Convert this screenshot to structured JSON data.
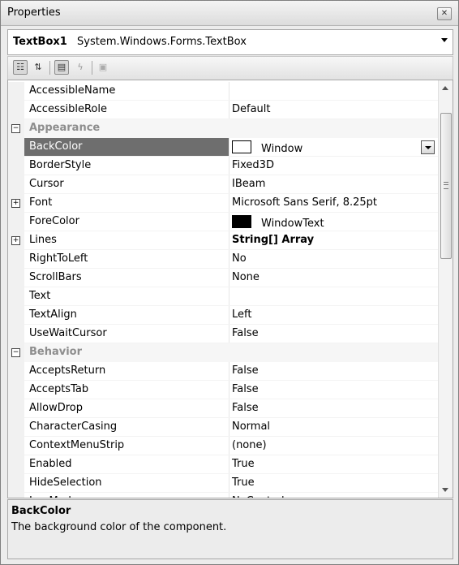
{
  "window": {
    "title": "Properties"
  },
  "object_selector": {
    "name": "TextBox1",
    "type": "System.Windows.Forms.TextBox"
  },
  "toolbar": {
    "categorized_icon": "categorized-icon",
    "alphabetical_icon": "alphabetical-icon",
    "properties_icon": "properties-icon",
    "events_icon": "events-icon",
    "property_pages_icon": "property-pages-icon"
  },
  "grid": {
    "rows": [
      {
        "kind": "prop",
        "name": "AccessibleName",
        "value": ""
      },
      {
        "kind": "prop",
        "name": "AccessibleRole",
        "value": "Default"
      },
      {
        "kind": "cat",
        "name": "Appearance",
        "expander": "⊟"
      },
      {
        "kind": "prop",
        "name": "BackColor",
        "value": "Window",
        "selected": true,
        "swatch": "#ffffff"
      },
      {
        "kind": "prop",
        "name": "BorderStyle",
        "value": "Fixed3D"
      },
      {
        "kind": "prop",
        "name": "Cursor",
        "value": "IBeam"
      },
      {
        "kind": "prop",
        "name": "Font",
        "value": "Microsoft Sans Serif, 8.25pt",
        "expander": "+"
      },
      {
        "kind": "prop",
        "name": "ForeColor",
        "value": "WindowText",
        "swatch": "#000000"
      },
      {
        "kind": "prop",
        "name": "Lines",
        "value": "String[] Array",
        "expander": "+",
        "bold_value": true
      },
      {
        "kind": "prop",
        "name": "RightToLeft",
        "value": "No"
      },
      {
        "kind": "prop",
        "name": "ScrollBars",
        "value": "None"
      },
      {
        "kind": "prop",
        "name": "Text",
        "value": ""
      },
      {
        "kind": "prop",
        "name": "TextAlign",
        "value": "Left"
      },
      {
        "kind": "prop",
        "name": "UseWaitCursor",
        "value": "False"
      },
      {
        "kind": "cat",
        "name": "Behavior",
        "expander": "⊟"
      },
      {
        "kind": "prop",
        "name": "AcceptsReturn",
        "value": "False"
      },
      {
        "kind": "prop",
        "name": "AcceptsTab",
        "value": "False"
      },
      {
        "kind": "prop",
        "name": "AllowDrop",
        "value": "False"
      },
      {
        "kind": "prop",
        "name": "CharacterCasing",
        "value": "Normal"
      },
      {
        "kind": "prop",
        "name": "ContextMenuStrip",
        "value": "(none)"
      },
      {
        "kind": "prop",
        "name": "Enabled",
        "value": "True"
      },
      {
        "kind": "prop",
        "name": "HideSelection",
        "value": "True"
      },
      {
        "kind": "prop",
        "name": "ImeMode",
        "value": "NoControl"
      }
    ]
  },
  "description": {
    "title": "BackColor",
    "text": "The background color of the component."
  }
}
